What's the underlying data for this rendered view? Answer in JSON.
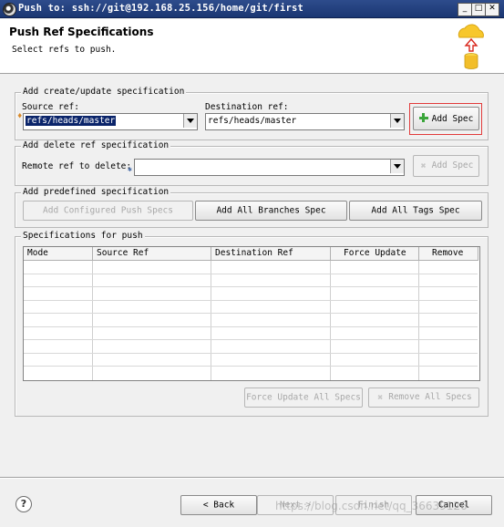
{
  "window": {
    "title": "Push to: ssh://git@192.168.25.156/home/git/first",
    "minimize_glyph": "_",
    "maximize_glyph": "□",
    "close_glyph": "✕"
  },
  "header": {
    "title": "Push Ref Specifications",
    "subtitle": "Select refs to push."
  },
  "create_group": {
    "legend": "Add create/update specification",
    "source_label": "Source ref:",
    "source_value": "refs/heads/master",
    "destination_label": "Destination ref:",
    "destination_value": "refs/heads/master",
    "add_button": "Add Spec"
  },
  "delete_group": {
    "legend": "Add delete ref specification",
    "remote_label": "Remote ref to delete:",
    "remote_value": "",
    "add_button": "Add Spec"
  },
  "predefined_group": {
    "legend": "Add predefined specification",
    "configured_button": "Add Configured Push Specs",
    "branches_button": "Add All Branches Spec",
    "tags_button": "Add All Tags Spec"
  },
  "specs_group": {
    "legend": "Specifications for push",
    "columns": [
      "Mode",
      "Source Ref",
      "Destination Ref",
      "Force Update",
      "Remove"
    ],
    "force_all_button": "Force Update All Specs",
    "remove_all_button": "Remove All Specs"
  },
  "footer": {
    "back_button": "< Back",
    "next_button": "Next >",
    "finish_button": "Finish",
    "cancel_button": "Cancel",
    "watermark": "https://blog.csdn.net/qq_36639126"
  },
  "icons": {
    "help": "help-icon",
    "wizard": "cloud-push-icon",
    "add": "plus-icon"
  },
  "colors": {
    "titlebar": "#1a3672",
    "highlight": "#e23b3b",
    "selection": "#0a246a"
  }
}
